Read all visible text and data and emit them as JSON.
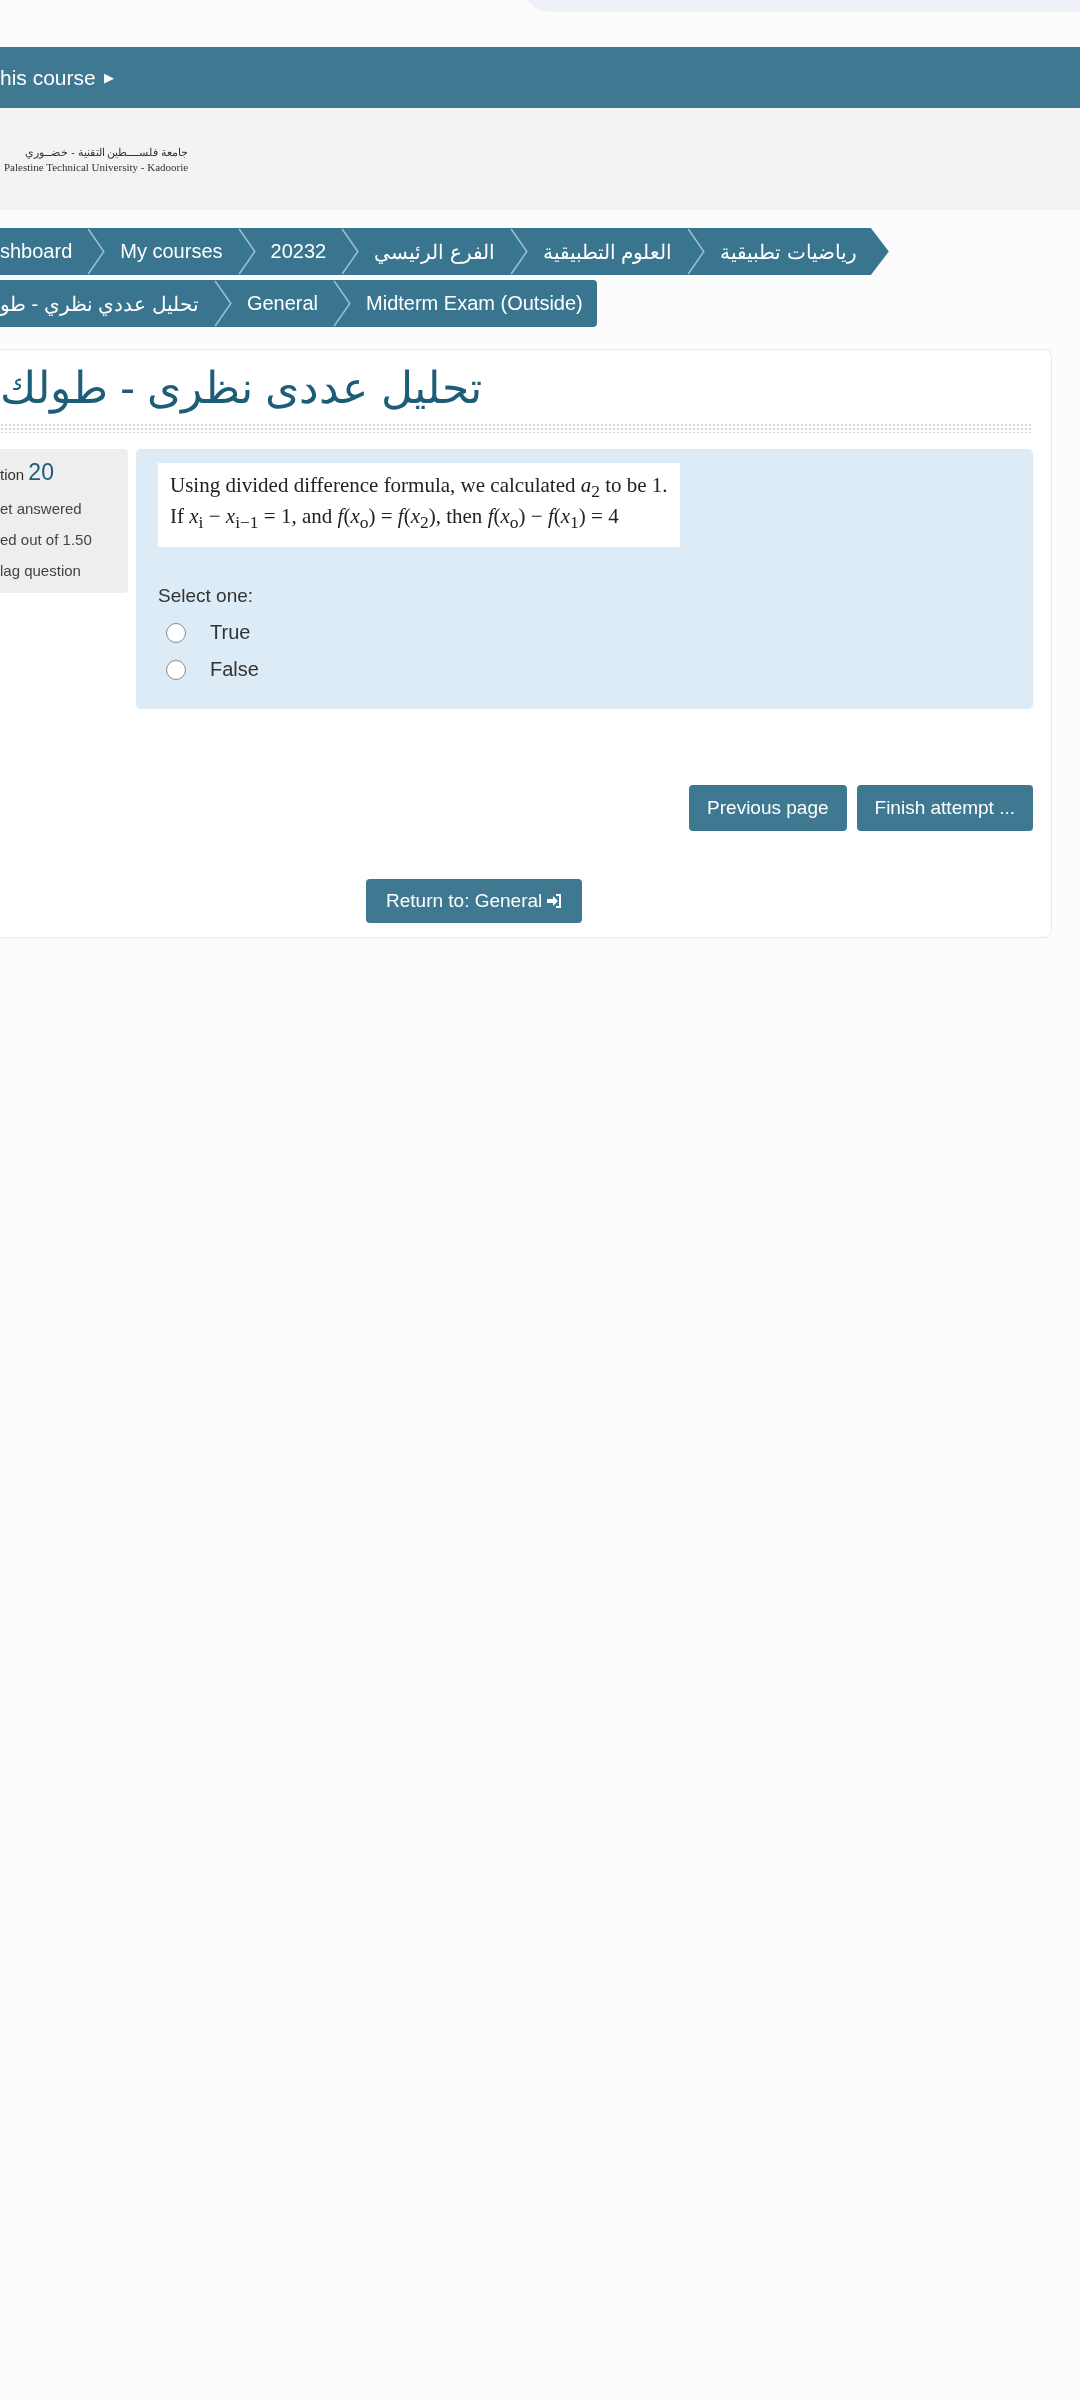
{
  "top_bar": {
    "label": "his course",
    "caret": "▶"
  },
  "logo": {
    "arabic": "جامعة فلســــطين التقنية - خضــوري",
    "english": "Palestine Technical University - Kadoorie"
  },
  "breadcrumbs": [
    {
      "rows": [
        "shboard",
        "My courses",
        "20232",
        "الفرع الرئيسي",
        "العلوم التطبيقية",
        "رياضيات تطبيقية"
      ]
    },
    {
      "rows": [
        "تحليل عددي نظري - طو",
        "General",
        "Midterm Exam (Outside)"
      ]
    }
  ],
  "page_title": "تحليل عددى نظرى - طولك",
  "question_info": {
    "number_label": "tion",
    "number": "20",
    "status": "et answered",
    "marks": "ed out of 1.50",
    "flag": "lag question"
  },
  "question": {
    "lines": [
      "Using divided difference formula, we calculated *a*$_{2}$ to be 1.",
      "If *x*$_{i}$ − *x*$_{i−1}$ = 1, and *f*(*x*$_{o}$) = *f*(*x*$_{2}$), then *f*(*x*$_{o}$) − *f*(*x*$_{1}$) = 4"
    ],
    "prompt": "Select one:",
    "options": [
      {
        "label": "True",
        "selected": false
      },
      {
        "label": "False",
        "selected": false
      }
    ]
  },
  "buttons": [
    "Previous page",
    "Finish attempt ..."
  ],
  "return_link": "Return to: General"
}
